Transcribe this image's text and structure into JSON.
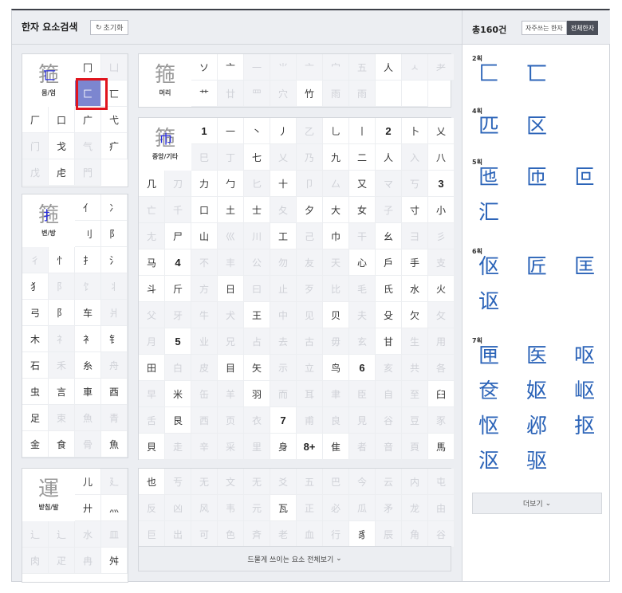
{
  "header": {
    "title": "한자 요소검색",
    "reset_label": "초기화",
    "reset_icon": "refresh-icon"
  },
  "panels": {
    "top_left": {
      "label": {
        "big": "箍",
        "hl": "匸",
        "caption": "몸/엄"
      },
      "cells": [
        "冂",
        "凵",
        "匚",
        "匸",
        "厂",
        "口",
        "广",
        "弋",
        "门",
        "戈",
        "气",
        "疒",
        "戊",
        "虍",
        "門"
      ],
      "dim": [
        false,
        true,
        false,
        false,
        false,
        false,
        false,
        false,
        true,
        false,
        true,
        false,
        true,
        false,
        true
      ]
    },
    "top_right": {
      "label": {
        "big": "箍",
        "caption": "머리"
      },
      "cells": [
        "ソ",
        "亠",
        "一",
        "⺌",
        "亠",
        "宀",
        "五",
        "人",
        "ㅅ",
        "耂",
        "艹",
        "廿",
        "罒",
        "穴",
        "竹",
        "雨",
        "雨",
        "",
        ""
      ],
      "dim": [
        false,
        false,
        true,
        true,
        true,
        true,
        true,
        false,
        true,
        true,
        false,
        true,
        true,
        true,
        false,
        true,
        true,
        false,
        false
      ]
    },
    "mid_left": {
      "label": {
        "big": "箍",
        "hl": "扌",
        "caption": "변/방"
      },
      "cells": [
        "亻",
        "冫",
        "刂",
        "⻖",
        "彳",
        "忄",
        "扌",
        "氵",
        "犭",
        "阝",
        "饣",
        "丬",
        "弓",
        "阝",
        "车",
        "爿",
        "木",
        "礻",
        "衤",
        "钅",
        "石",
        "禾",
        "糸",
        "舟",
        "虫",
        "言",
        "車",
        "酉",
        "足",
        "束",
        "魚",
        "青",
        "金",
        "食",
        "骨",
        "魚"
      ],
      "dim": [
        false,
        false,
        false,
        false,
        true,
        false,
        false,
        false,
        false,
        true,
        true,
        true,
        false,
        false,
        false,
        true,
        false,
        true,
        false,
        false,
        false,
        true,
        false,
        true,
        false,
        false,
        false,
        false,
        false,
        true,
        true,
        true,
        false,
        false,
        true,
        false
      ]
    },
    "mid_right": {
      "label": {
        "big": "箍",
        "hl": "巾",
        "caption": "중앙/기타"
      },
      "row1": [
        "1",
        "一",
        "丶",
        "丿",
        "乙",
        "乚",
        "丨",
        "2",
        "卜",
        "乂"
      ],
      "row1dim": [
        false,
        false,
        false,
        false,
        true,
        false,
        false,
        false,
        false,
        false
      ],
      "rows": [
        [
          "巳",
          "丁",
          "七",
          "乂",
          "乃",
          "九",
          "二",
          "人",
          "入",
          "八"
        ],
        [
          "几",
          "刀",
          "力",
          "勹",
          "匕",
          "十",
          "卩",
          "厶",
          "又",
          "マ",
          "丂",
          "3"
        ],
        [
          "亡",
          "千",
          "口",
          "土",
          "士",
          "夂",
          "夕",
          "大",
          "女",
          "子",
          "寸",
          "小"
        ],
        [
          "尢",
          "尸",
          "山",
          "巛",
          "川",
          "工",
          "己",
          "巾",
          "干",
          "幺",
          "彐",
          "彡"
        ],
        [
          "马",
          "4",
          "不",
          "丰",
          "公",
          "勿",
          "友",
          "天",
          "心",
          "戶",
          "手",
          "支"
        ],
        [
          "斗",
          "斤",
          "方",
          "日",
          "曰",
          "止",
          "歹",
          "比",
          "毛",
          "氏",
          "水",
          "火"
        ],
        [
          "父",
          "牙",
          "牛",
          "犬",
          "王",
          "中",
          "见",
          "贝",
          "夫",
          "殳",
          "欠",
          "攵"
        ],
        [
          "月",
          "5",
          "业",
          "兄",
          "占",
          "去",
          "古",
          "毋",
          "玄",
          "甘",
          "生",
          "用"
        ],
        [
          "田",
          "白",
          "皮",
          "目",
          "矢",
          "示",
          "立",
          "鸟",
          "6",
          "亥",
          "共",
          "各"
        ],
        [
          "早",
          "米",
          "缶",
          "羊",
          "羽",
          "而",
          "耳",
          "聿",
          "臣",
          "自",
          "至",
          "臼"
        ],
        [
          "舌",
          "艮",
          "西",
          "页",
          "衣",
          "7",
          "甫",
          "良",
          "見",
          "谷",
          "豆",
          "豕"
        ],
        [
          "貝",
          "走",
          "辛",
          "采",
          "里",
          "身",
          "8+",
          "隹",
          "者",
          "音",
          "頁",
          "馬"
        ]
      ],
      "rowsdim": [
        [
          true,
          true,
          false,
          true,
          true,
          false,
          false,
          false,
          true,
          false
        ],
        [
          false,
          true,
          false,
          false,
          true,
          false,
          true,
          true,
          false,
          true,
          true,
          false
        ],
        [
          true,
          true,
          false,
          false,
          false,
          true,
          false,
          false,
          false,
          true,
          false,
          false
        ],
        [
          true,
          false,
          false,
          true,
          true,
          false,
          true,
          false,
          true,
          false,
          true,
          true
        ],
        [
          false,
          false,
          true,
          true,
          true,
          true,
          true,
          true,
          false,
          false,
          false,
          true
        ],
        [
          false,
          false,
          true,
          false,
          true,
          true,
          true,
          true,
          true,
          false,
          false,
          false
        ],
        [
          true,
          true,
          true,
          true,
          false,
          true,
          true,
          false,
          true,
          false,
          false,
          true
        ],
        [
          true,
          false,
          true,
          true,
          true,
          true,
          true,
          true,
          true,
          false,
          true,
          true
        ],
        [
          false,
          true,
          true,
          false,
          false,
          true,
          true,
          false,
          false,
          true,
          true,
          true
        ],
        [
          true,
          false,
          true,
          true,
          false,
          true,
          true,
          true,
          true,
          true,
          true,
          false
        ],
        [
          true,
          false,
          true,
          true,
          true,
          false,
          true,
          true,
          true,
          true,
          true,
          true
        ],
        [
          false,
          true,
          true,
          true,
          true,
          false,
          false,
          false,
          true,
          true,
          true,
          false
        ]
      ]
    },
    "bottom_left": {
      "label": {
        "big": "運",
        "caption": "받침/발"
      },
      "cells": [
        "儿",
        "廴",
        "廾",
        "灬",
        "辶",
        "辶",
        "水",
        "皿",
        "肉",
        "疋",
        "冉",
        "舛"
      ],
      "dim": [
        false,
        true,
        false,
        false,
        true,
        true,
        true,
        true,
        true,
        true,
        true,
        false
      ]
    },
    "bottom_right": {
      "cells": [
        "也",
        "亐",
        "无",
        "文",
        "无",
        "爻",
        "五",
        "巴",
        "今",
        "云",
        "内",
        "屯",
        "反",
        "凶",
        "风",
        "韦",
        "元",
        "瓦",
        "正",
        "必",
        "瓜",
        "矛",
        "龙",
        "由",
        "巨",
        "出",
        "可",
        "色",
        "斉",
        "老",
        "血",
        "行",
        "豸",
        "辰",
        "角",
        "谷"
      ],
      "dim": [
        false,
        true,
        true,
        true,
        true,
        true,
        true,
        true,
        true,
        true,
        true,
        true,
        true,
        true,
        true,
        true,
        true,
        false,
        true,
        true,
        true,
        true,
        true,
        true,
        true,
        true,
        true,
        true,
        true,
        true,
        true,
        true,
        false,
        true,
        true,
        true
      ],
      "more_label": "드물게 쓰이는 요소 전체보기"
    }
  },
  "right": {
    "total": "총160건",
    "tabs": [
      "자주쓰는 한자",
      "전체한자"
    ],
    "groups": [
      {
        "stroke": "2획",
        "chars": [
          "匚",
          "匸"
        ]
      },
      {
        "stroke": "4획",
        "chars": [
          "匹",
          "区"
        ]
      },
      {
        "stroke": "5획",
        "chars": [
          "匜",
          "匝",
          "叵",
          "汇"
        ]
      },
      {
        "stroke": "6획",
        "chars": [
          "伛",
          "匠",
          "匡",
          "讴"
        ]
      },
      {
        "stroke": "7획",
        "chars": [
          "匣",
          "医",
          "呕",
          "奁",
          "妪",
          "岖",
          "怄",
          "邲",
          "抠",
          "沤",
          "驱"
        ]
      }
    ],
    "more_label": "더보기"
  }
}
